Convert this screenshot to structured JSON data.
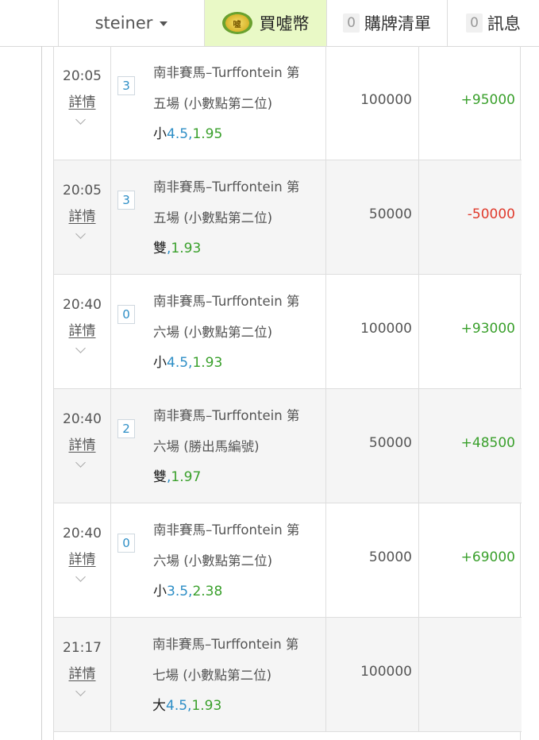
{
  "header": {
    "username": "steiner",
    "coin_icon_text": "噓",
    "coin_label": "買噓幣",
    "cart_count": "0",
    "cart_label": "購牌清單",
    "msg_count": "0",
    "msg_label": "訊息"
  },
  "detail_label": "詳情",
  "colors": {
    "positive": "#3aa02c",
    "negative": "#e03a2c",
    "link_blue": "#2d8ec6",
    "coin_bg": "#e9f9c6"
  },
  "bets": [
    {
      "time": "20:05",
      "badge": "3",
      "desc1": "南非賽馬–Turffontein 第",
      "desc2": "五場 (小數點第二位)",
      "selection": "小",
      "line": "4.5",
      "sep": ",",
      "odds": "1.95",
      "amount": "100000",
      "result": "+95000",
      "result_type": "pos"
    },
    {
      "time": "20:05",
      "badge": "3",
      "desc1": "南非賽馬–Turffontein 第",
      "desc2": "五場 (小數點第二位)",
      "selection": "雙",
      "line": "",
      "sep": ",",
      "odds": "1.93",
      "amount": "50000",
      "result": "-50000",
      "result_type": "neg"
    },
    {
      "time": "20:40",
      "badge": "0",
      "desc1": "南非賽馬–Turffontein 第",
      "desc2": "六場 (小數點第二位)",
      "selection": "小",
      "line": "4.5",
      "sep": ",",
      "odds": "1.93",
      "amount": "100000",
      "result": "+93000",
      "result_type": "pos"
    },
    {
      "time": "20:40",
      "badge": "2",
      "desc1": "南非賽馬–Turffontein 第",
      "desc2": "六場 (勝出馬編號)",
      "selection": "雙",
      "line": "",
      "sep": ",",
      "odds": "1.97",
      "amount": "50000",
      "result": "+48500",
      "result_type": "pos"
    },
    {
      "time": "20:40",
      "badge": "0",
      "desc1": "南非賽馬–Turffontein 第",
      "desc2": "六場 (小數點第二位)",
      "selection": "小",
      "line": "3.5",
      "sep": ",",
      "odds": "2.38",
      "amount": "50000",
      "result": "+69000",
      "result_type": "pos"
    },
    {
      "time": "21:17",
      "badge": "",
      "desc1": "南非賽馬–Turffontein 第",
      "desc2": "七場 (小數點第二位)",
      "selection": "大",
      "line": "4.5",
      "sep": ",",
      "odds": "1.93",
      "amount": "100000",
      "result": "",
      "result_type": "none"
    }
  ]
}
